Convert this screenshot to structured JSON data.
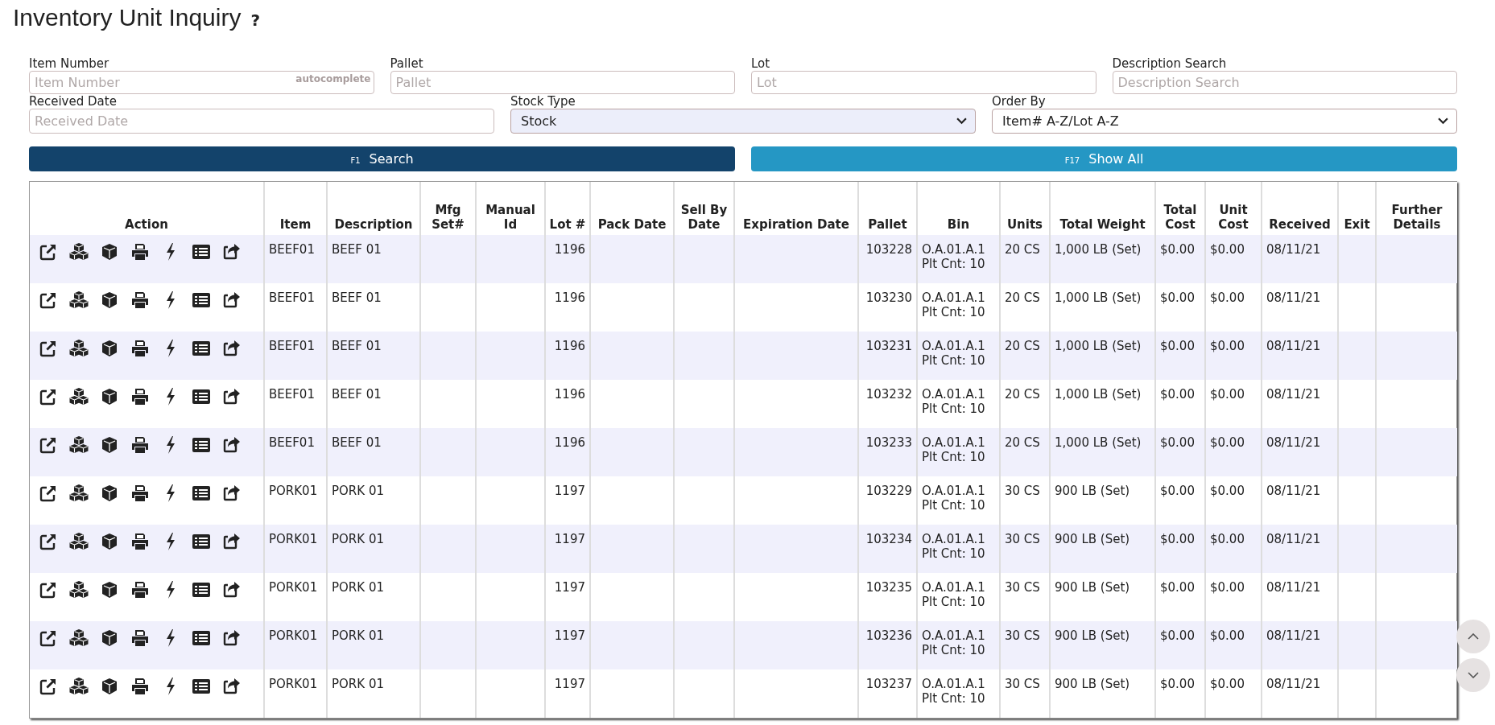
{
  "page": {
    "title": "Inventory Unit Inquiry",
    "help": "?"
  },
  "filters": {
    "row_1": [
      {
        "label": "Item Number",
        "placeholder": "Item Number",
        "hint": "autocomplete"
      },
      {
        "label": "Pallet",
        "placeholder": "Pallet"
      },
      {
        "label": "Lot",
        "placeholder": "Lot"
      },
      {
        "label": "Description Search",
        "placeholder": "Description Search"
      }
    ],
    "received_date": {
      "label": "Received Date",
      "placeholder": "Received Date"
    },
    "stock_type": {
      "label": "Stock Type",
      "value": "Stock"
    },
    "order_by": {
      "label": "Order By",
      "value": "Item# A-Z/Lot A-Z"
    }
  },
  "buttons": [
    {
      "key": "F1",
      "label": "Search",
      "kind": "primary"
    },
    {
      "key": "F17",
      "label": "Show All",
      "kind": "secondary"
    }
  ],
  "table": {
    "columns": [
      "Action",
      "Item",
      "Description",
      "Mfg Set#",
      "Manual Id",
      "Lot #",
      "Pack Date",
      "Sell By Date",
      "Expiration Date",
      "Pallet",
      "Bin",
      "Units",
      "Total Weight",
      "Total Cost",
      "Unit Cost",
      "Received",
      "Exit",
      "Further Details"
    ],
    "rows": [
      {
        "item": "BEEF01",
        "description": "BEEF 01",
        "lot": "1196",
        "pallet": "103228",
        "bin": "O.A.01.A.1",
        "pallet_count": "Plt Cnt: 10",
        "units": "20 CS",
        "total_weight": "1,000 LB (Set)",
        "total_cost": "$0.00",
        "unit_cost": "$0.00",
        "received": "08/11/21"
      },
      {
        "item": "BEEF01",
        "description": "BEEF 01",
        "lot": "1196",
        "pallet": "103230",
        "bin": "O.A.01.A.1",
        "pallet_count": "Plt Cnt: 10",
        "units": "20 CS",
        "total_weight": "1,000 LB (Set)",
        "total_cost": "$0.00",
        "unit_cost": "$0.00",
        "received": "08/11/21"
      },
      {
        "item": "BEEF01",
        "description": "BEEF 01",
        "lot": "1196",
        "pallet": "103231",
        "bin": "O.A.01.A.1",
        "pallet_count": "Plt Cnt: 10",
        "units": "20 CS",
        "total_weight": "1,000 LB (Set)",
        "total_cost": "$0.00",
        "unit_cost": "$0.00",
        "received": "08/11/21"
      },
      {
        "item": "BEEF01",
        "description": "BEEF 01",
        "lot": "1196",
        "pallet": "103232",
        "bin": "O.A.01.A.1",
        "pallet_count": "Plt Cnt: 10",
        "units": "20 CS",
        "total_weight": "1,000 LB (Set)",
        "total_cost": "$0.00",
        "unit_cost": "$0.00",
        "received": "08/11/21"
      },
      {
        "item": "BEEF01",
        "description": "BEEF 01",
        "lot": "1196",
        "pallet": "103233",
        "bin": "O.A.01.A.1",
        "pallet_count": "Plt Cnt: 10",
        "units": "20 CS",
        "total_weight": "1,000 LB (Set)",
        "total_cost": "$0.00",
        "unit_cost": "$0.00",
        "received": "08/11/21"
      },
      {
        "item": "PORK01",
        "description": "PORK 01",
        "lot": "1197",
        "pallet": "103229",
        "bin": "O.A.01.A.1",
        "pallet_count": "Plt Cnt: 10",
        "units": "30 CS",
        "total_weight": "900 LB (Set)",
        "total_cost": "$0.00",
        "unit_cost": "$0.00",
        "received": "08/11/21"
      },
      {
        "item": "PORK01",
        "description": "PORK 01",
        "lot": "1197",
        "pallet": "103234",
        "bin": "O.A.01.A.1",
        "pallet_count": "Plt Cnt: 10",
        "units": "30 CS",
        "total_weight": "900 LB (Set)",
        "total_cost": "$0.00",
        "unit_cost": "$0.00",
        "received": "08/11/21"
      },
      {
        "item": "PORK01",
        "description": "PORK 01",
        "lot": "1197",
        "pallet": "103235",
        "bin": "O.A.01.A.1",
        "pallet_count": "Plt Cnt: 10",
        "units": "30 CS",
        "total_weight": "900 LB (Set)",
        "total_cost": "$0.00",
        "unit_cost": "$0.00",
        "received": "08/11/21"
      },
      {
        "item": "PORK01",
        "description": "PORK 01",
        "lot": "1197",
        "pallet": "103236",
        "bin": "O.A.01.A.1",
        "pallet_count": "Plt Cnt: 10",
        "units": "30 CS",
        "total_weight": "900 LB (Set)",
        "total_cost": "$0.00",
        "unit_cost": "$0.00",
        "received": "08/11/21"
      },
      {
        "item": "PORK01",
        "description": "PORK 01",
        "lot": "1197",
        "pallet": "103237",
        "bin": "O.A.01.A.1",
        "pallet_count": "Plt Cnt: 10",
        "units": "30 CS",
        "total_weight": "900 LB (Set)",
        "total_cost": "$0.00",
        "unit_cost": "$0.00",
        "received": "08/11/21"
      }
    ]
  }
}
